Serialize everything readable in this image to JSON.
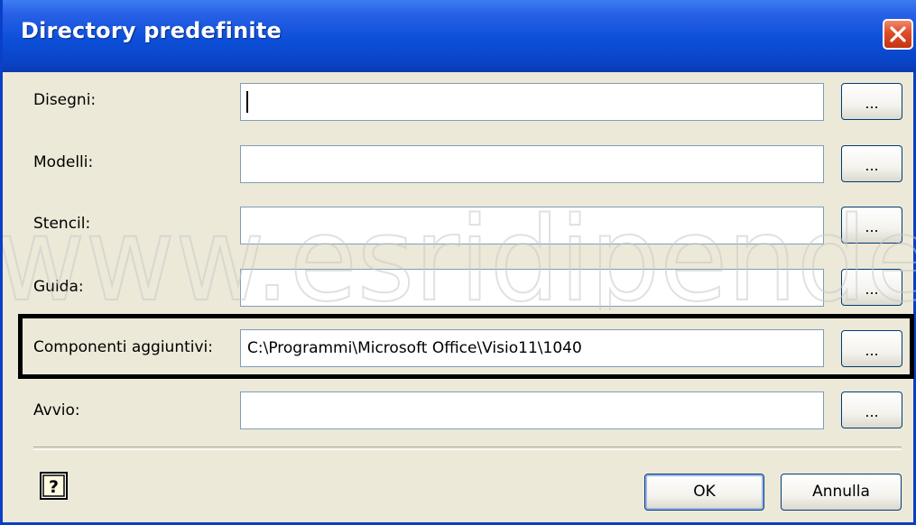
{
  "window": {
    "title": "Directory predefinite"
  },
  "rows": [
    {
      "label": "Disegni:",
      "value": ""
    },
    {
      "label": "Modelli:",
      "value": ""
    },
    {
      "label": "Stencil:",
      "value": ""
    },
    {
      "label": "Guida:",
      "value": ""
    },
    {
      "label": "Componenti aggiuntivi:",
      "value": "C:\\Programmi\\Microsoft Office\\Visio11\\1040"
    },
    {
      "label": "Avvio:",
      "value": ""
    }
  ],
  "browse_label": "...",
  "buttons": {
    "ok": "OK",
    "cancel": "Annulla",
    "help_glyph": "?"
  },
  "watermark_text": "www.esridipende",
  "colors": {
    "titlebar": "#0d4fd9",
    "dialog_bg": "#ece9d8",
    "close": "#de4b27",
    "highlight": "#000000"
  }
}
